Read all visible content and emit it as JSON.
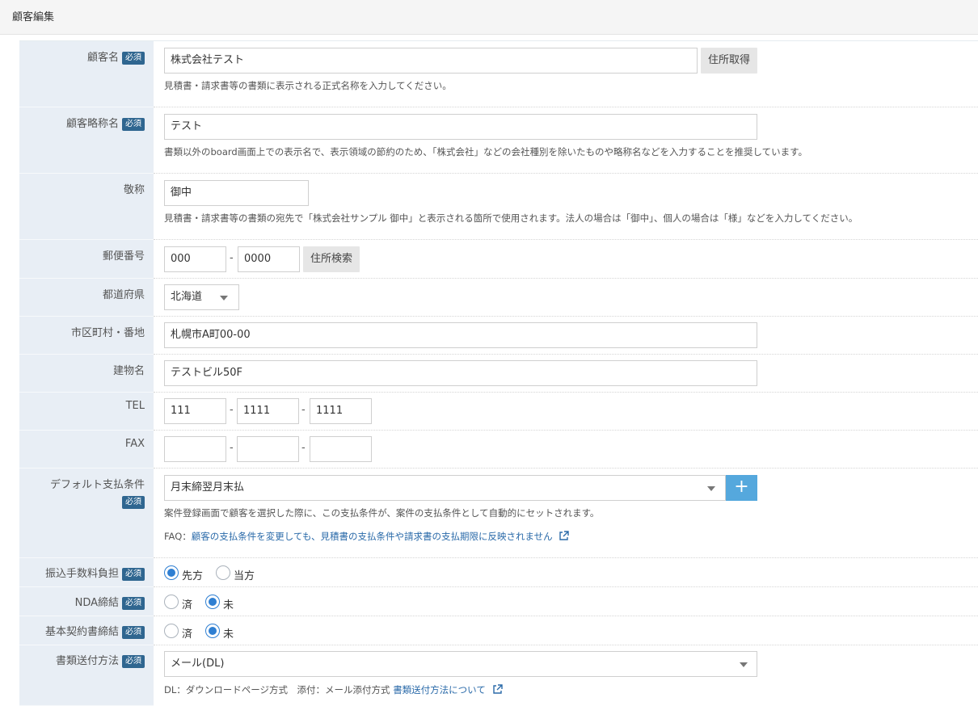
{
  "page": {
    "title": "顧客編集"
  },
  "required_badge": "必須",
  "fields": {
    "customer_name": {
      "label": "顧客名",
      "value": "株式会社テスト",
      "button": "住所取得",
      "hint": "見積書・請求書等の書類に表示される正式名称を入力してください。"
    },
    "customer_short_name": {
      "label": "顧客略称名",
      "value": "テスト",
      "hint": "書類以外のboard画面上での表示名で、表示領域の節約のため、「株式会社」などの会社種別を除いたものや略称名などを入力することを推奨しています。"
    },
    "honorific": {
      "label": "敬称",
      "value": "御中",
      "hint": "見積書・請求書等の書類の宛先で「株式会社サンプル 御中」と表示される箇所で使用されます。法人の場合は「御中」、個人の場合は「様」などを入力してください。"
    },
    "postal_code": {
      "label": "郵便番号",
      "part1": "000",
      "part2": "0000",
      "separator": "-",
      "button": "住所検索"
    },
    "prefecture": {
      "label": "都道府県",
      "value": "北海道"
    },
    "city": {
      "label": "市区町村・番地",
      "value": "札幌市A町00-00"
    },
    "building": {
      "label": "建物名",
      "value": "テストビル50F"
    },
    "tel": {
      "label": "TEL",
      "part1": "111",
      "part2": "1111",
      "part3": "1111",
      "separator": "-"
    },
    "fax": {
      "label": "FAX",
      "part1": "",
      "part2": "",
      "part3": "",
      "separator": "-"
    },
    "payment_terms": {
      "label": "デフォルト支払条件",
      "value": "月末締翌月末払",
      "add_button": "+",
      "hint": "案件登録画面で顧客を選択した際に、この支払条件が、案件の支払条件として自動的にセットされます。",
      "faq_prefix": "FAQ：",
      "faq_link": "顧客の支払条件を変更しても、見積書の支払条件や請求書の支払期限に反映されません"
    },
    "transfer_fee": {
      "label": "振込手数料負担",
      "options": [
        "先方",
        "当方"
      ],
      "selected": "先方"
    },
    "nda": {
      "label": "NDA締結",
      "options": [
        "済",
        "未"
      ],
      "selected": "未"
    },
    "basic_contract": {
      "label": "基本契約書締結",
      "options": [
        "済",
        "未"
      ],
      "selected": "未"
    },
    "document_delivery": {
      "label": "書類送付方法",
      "value": "メール(DL)",
      "hint": "DL：ダウンロードページ方式　添付：メール添付方式",
      "link": "書類送付方法について"
    }
  },
  "colors": {
    "label_bg": "#e8eef5",
    "required_badge": "#2f6690",
    "accent_blue": "#55a8dd",
    "link": "#2a6aa9",
    "radio_checked": "#2f7fd2"
  }
}
